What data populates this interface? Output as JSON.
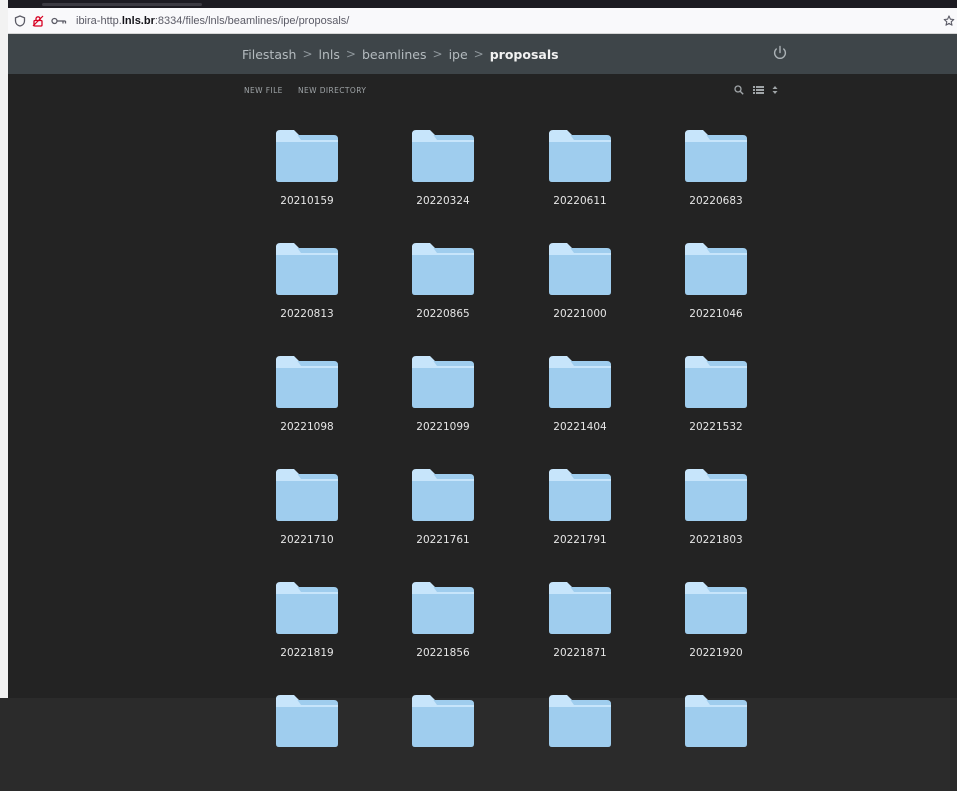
{
  "browser": {
    "url_prefix": "ibira-http.",
    "url_host": "lnls.br",
    "url_rest": ":8334/files/lnls/beamlines/ipe/proposals/"
  },
  "header": {
    "breadcrumb": [
      "Filestash",
      "lnls",
      "beamlines",
      "ipe",
      "proposals"
    ]
  },
  "actions": {
    "new_file": "NEW FILE",
    "new_directory": "NEW DIRECTORY"
  },
  "folders": [
    "20210159",
    "20220324",
    "20220611",
    "20220683",
    "20220813",
    "20220865",
    "20221000",
    "20221046",
    "20221098",
    "20221099",
    "20221404",
    "20221532",
    "20221710",
    "20221761",
    "20221791",
    "20221803",
    "20221819",
    "20221856",
    "20221871",
    "20221920",
    "",
    "",
    "",
    ""
  ],
  "colors": {
    "folder_body": "#9fcdee",
    "folder_tab": "#c7e5fb",
    "background": "#232323",
    "header": "#3e4549"
  }
}
